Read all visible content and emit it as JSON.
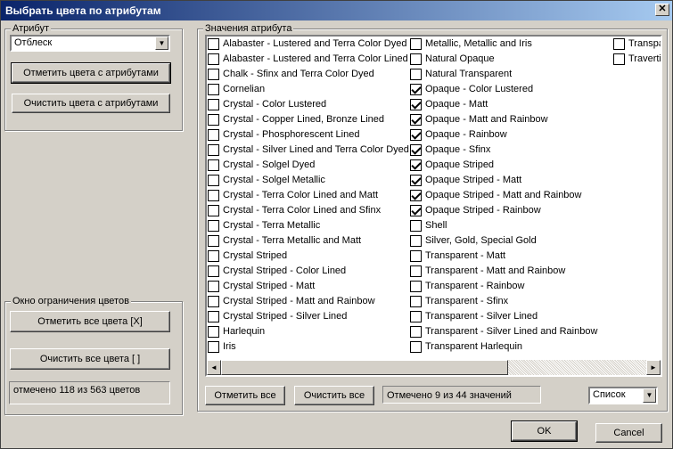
{
  "window": {
    "title": "Выбрать цвета по атрибутам",
    "close_glyph": "✕"
  },
  "attribute_group": {
    "label": "Атрибут",
    "selected": "Отблеск",
    "mark_button": "Отметить цвета с атрибутами",
    "clear_button": "Очистить цвета с атрибутами"
  },
  "restrict_group": {
    "label": "Окно ограничения цветов",
    "mark_all_button": "Отметить все цвета [X]",
    "clear_all_button": "Очистить все цвета [ ]",
    "status": "отмечено 118 из 563 цветов"
  },
  "values_group": {
    "label": "Значения атрибута",
    "col1": [
      {
        "label": "Alabaster - Lustered and Terra Color Dyed",
        "checked": false
      },
      {
        "label": "Alabaster - Lustered and Terra Color Lined",
        "checked": false
      },
      {
        "label": "Chalk - Sfinx and Terra Color Dyed",
        "checked": false
      },
      {
        "label": "Cornelian",
        "checked": false
      },
      {
        "label": "Crystal - Color Lustered",
        "checked": false
      },
      {
        "label": "Crystal - Copper Lined, Bronze Lined",
        "checked": false
      },
      {
        "label": "Crystal - Phosphorescent Lined",
        "checked": false
      },
      {
        "label": "Crystal - Silver Lined and Terra Color Dyed",
        "checked": false
      },
      {
        "label": "Crystal - Solgel Dyed",
        "checked": false
      },
      {
        "label": "Crystal - Solgel Metallic",
        "checked": false
      },
      {
        "label": "Crystal - Terra Color Lined and Matt",
        "checked": false
      },
      {
        "label": "Crystal - Terra Color Lined and Sfinx",
        "checked": false
      },
      {
        "label": "Crystal - Terra Metallic",
        "checked": false
      },
      {
        "label": "Crystal - Terra Metallic and Matt",
        "checked": false
      },
      {
        "label": "Crystal Striped",
        "checked": false
      },
      {
        "label": "Crystal Striped - Color Lined",
        "checked": false
      },
      {
        "label": "Crystal Striped - Matt",
        "checked": false
      },
      {
        "label": "Crystal Striped - Matt and Rainbow",
        "checked": false
      },
      {
        "label": "Crystal Striped - Silver Lined",
        "checked": false
      },
      {
        "label": "Harlequin",
        "checked": false
      },
      {
        "label": "Iris",
        "checked": false
      }
    ],
    "col2": [
      {
        "label": "Metallic, Metallic and Iris",
        "checked": false
      },
      {
        "label": "Natural Opaque",
        "checked": false
      },
      {
        "label": "Natural Transparent",
        "checked": false
      },
      {
        "label": "Opaque - Color Lustered",
        "checked": true
      },
      {
        "label": "Opaque - Matt",
        "checked": true
      },
      {
        "label": "Opaque - Matt and Rainbow",
        "checked": true
      },
      {
        "label": "Opaque - Rainbow",
        "checked": true
      },
      {
        "label": "Opaque - Sfinx",
        "checked": true
      },
      {
        "label": "Opaque Striped",
        "checked": true
      },
      {
        "label": "Opaque Striped - Matt",
        "checked": true
      },
      {
        "label": "Opaque Striped - Matt and Rainbow",
        "checked": true
      },
      {
        "label": "Opaque Striped - Rainbow",
        "checked": true
      },
      {
        "label": "Shell",
        "checked": false
      },
      {
        "label": "Silver, Gold, Special Gold",
        "checked": false
      },
      {
        "label": "Transparent - Matt",
        "checked": false
      },
      {
        "label": "Transparent - Matt and Rainbow",
        "checked": false
      },
      {
        "label": "Transparent - Rainbow",
        "checked": false
      },
      {
        "label": "Transparent - Sfinx",
        "checked": false
      },
      {
        "label": "Transparent - Silver Lined",
        "checked": false
      },
      {
        "label": "Transparent - Silver Lined and Rainbow",
        "checked": false
      },
      {
        "label": "Transparent Harlequin",
        "checked": false
      }
    ],
    "col3": [
      {
        "label": "Transpa",
        "checked": false
      },
      {
        "label": "Travertin",
        "checked": false
      }
    ],
    "scroll_left_glyph": "◄",
    "scroll_right_glyph": "►",
    "mark_all_button": "Отметить все",
    "clear_all_button": "Очистить все",
    "status": "Отмечено 9 из 44 значений",
    "view_mode": "Список"
  },
  "footer": {
    "ok_button": "OK",
    "cancel_button": "Cancel"
  },
  "icons": {
    "combo_arrow": "▼"
  }
}
